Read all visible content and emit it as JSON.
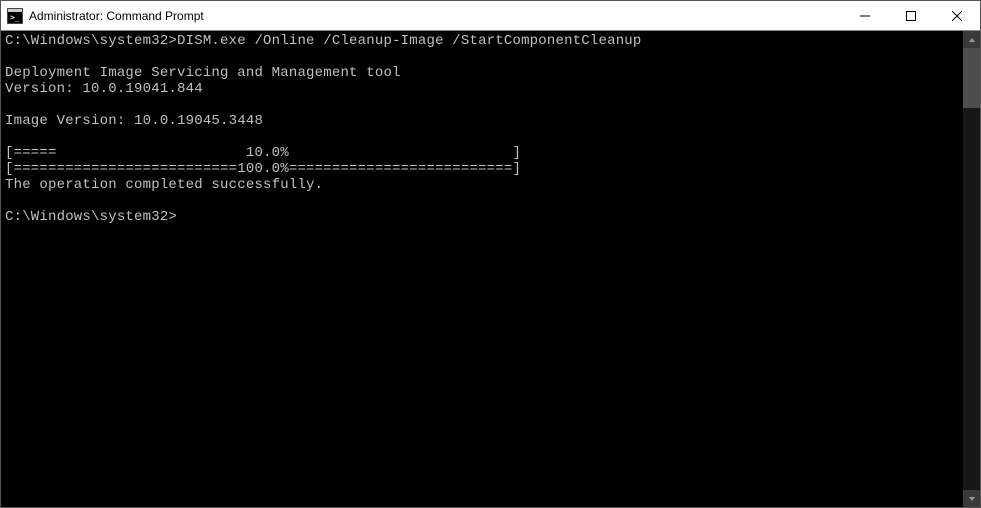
{
  "window": {
    "title": "Administrator: Command Prompt"
  },
  "console": {
    "prompt1_path": "C:\\Windows\\system32>",
    "prompt1_cmd": "DISM.exe /Online /Cleanup-Image /StartComponentCleanup",
    "tool_name": "Deployment Image Servicing and Management tool",
    "version_line": "Version: 10.0.19041.844",
    "image_version_line": "Image Version: 10.0.19045.3448",
    "progress_line1": "[=====                      10.0%                          ]",
    "progress_line2": "[==========================100.0%==========================]",
    "completed": "The operation completed successfully.",
    "prompt2": "C:\\Windows\\system32>"
  }
}
